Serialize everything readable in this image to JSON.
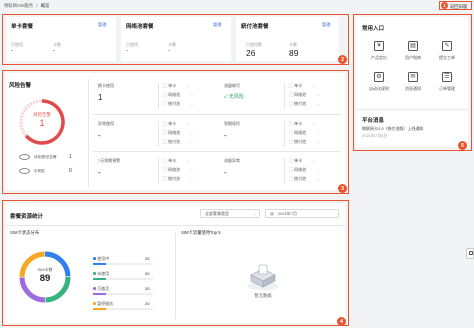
{
  "breadcrumb": {
    "root": "物联网SIM服务",
    "sep": "/",
    "current": "概览"
  },
  "header": {
    "return_label": "返回旧版",
    "badge": "1"
  },
  "cards": {
    "single": {
      "title": "单卡套餐",
      "manage": "管理",
      "k1": "已使用",
      "k2": "卡数",
      "v1": "-",
      "v2": "-"
    },
    "pool": {
      "title": "网络池套餐",
      "manage": "管理",
      "k1": "已使用",
      "k2": "卡数",
      "v1": "-",
      "v2": "-"
    },
    "bank": {
      "title": "統付池套餐",
      "manage": "管理",
      "k1": "已使用数",
      "k2": "卡数",
      "v1": "26",
      "v2": "89"
    },
    "badge": "2"
  },
  "risk": {
    "title": "风险告警",
    "gauge_label": "风险告警",
    "gauge_value": "1",
    "rows": [
      {
        "label": "待处理/总告警",
        "value": "1"
      },
      {
        "label": "中风险",
        "value": "0"
      }
    ],
    "cells": [
      {
        "title": "换卡使用",
        "value": "1",
        "items": [
          "单卡",
          "网络池",
          "統付池"
        ]
      },
      {
        "title": "流量耗尽",
        "value": "无风险",
        "items": [
          "单卡",
          "网络池",
          "統付池"
        ]
      },
      {
        "title": "异常使用",
        "value": "-",
        "items": [
          "单卡",
          "网络池",
          "統付池"
        ]
      },
      {
        "title": "到期续约",
        "value": "-",
        "items": [
          "单卡",
          "网络池",
          "統付池"
        ]
      },
      {
        "title": "7天到期预警",
        "value": "-",
        "items": [
          "单卡",
          "网络池",
          "統付池"
        ]
      },
      {
        "title": "流量异常",
        "value": "-",
        "items": [
          "单卡",
          "网络池",
          "統付池"
        ]
      }
    ],
    "badge": "3"
  },
  "stats": {
    "title": "套餐资源统计",
    "filter_type": "全部套餐类型",
    "filter_month": "2021年7月",
    "left_title": "SIM卡状态分布",
    "donut_label": "SIM卡数",
    "donut_value": "89",
    "legend": [
      {
        "name": "使用中",
        "value": "20",
        "color": "#2f80ed",
        "frac": 0.22
      },
      {
        "name": "未使用",
        "value": "20",
        "color": "#36b37e",
        "frac": 0.22
      },
      {
        "name": "可激活",
        "value": "20",
        "color": "#9b6bdf",
        "frac": 0.22
      },
      {
        "name": "暂停服务",
        "value": "20",
        "color": "#f5a623",
        "frac": 0.22
      }
    ],
    "right_title": "SIM卡流量使用Top 5",
    "empty_text": "暂无数据",
    "badge": "4"
  },
  "side": {
    "entry_title": "常用入口",
    "entries": [
      {
        "label": "产品定价",
        "icon": "price-tag-icon"
      },
      {
        "label": "用户指南",
        "icon": "book-icon"
      },
      {
        "label": "提交工单",
        "icon": "ticket-icon"
      },
      {
        "label": "自动化规则",
        "icon": "automation-icon"
      },
      {
        "label": "消息通知",
        "icon": "message-icon"
      },
      {
        "label": "订单管理",
        "icon": "order-icon"
      }
    ],
    "news_title": "平台消息",
    "news_text": "物联网卡2.0（统付池版）上线通知",
    "news_date": "2021年7月6日",
    "badge": "5"
  }
}
